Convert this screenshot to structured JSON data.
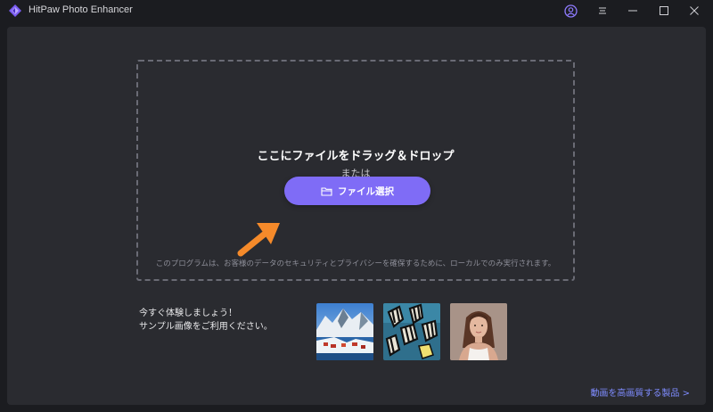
{
  "app": {
    "title": "HitPaw Photo Enhancer"
  },
  "colors": {
    "accent": "#7f6cf6",
    "background": "#1b1c20",
    "panel": "#2a2b30",
    "arrow": "#f58a2a",
    "link": "#7f8cff"
  },
  "titlebar": {
    "icons": [
      "account-icon",
      "menu-icon",
      "minimize-icon",
      "maximize-icon",
      "close-icon"
    ]
  },
  "dropzone": {
    "title": "ここにファイルをドラッグ＆ドロップ",
    "or_text": "または",
    "button_label": "ファイル選択",
    "privacy_note": "このプログラムは、お客様のデータのセキュリティとプライバシーを確保するために、ローカルでのみ実行されます。"
  },
  "samples": {
    "line1": "今すぐ体験しましょう！",
    "line2": "サンプル画像をご利用ください。",
    "images": [
      "snowy-village-image",
      "zebra-fish-image",
      "woman-portrait-image"
    ]
  },
  "footer": {
    "video_link": "動画を高画質する製品 >"
  }
}
